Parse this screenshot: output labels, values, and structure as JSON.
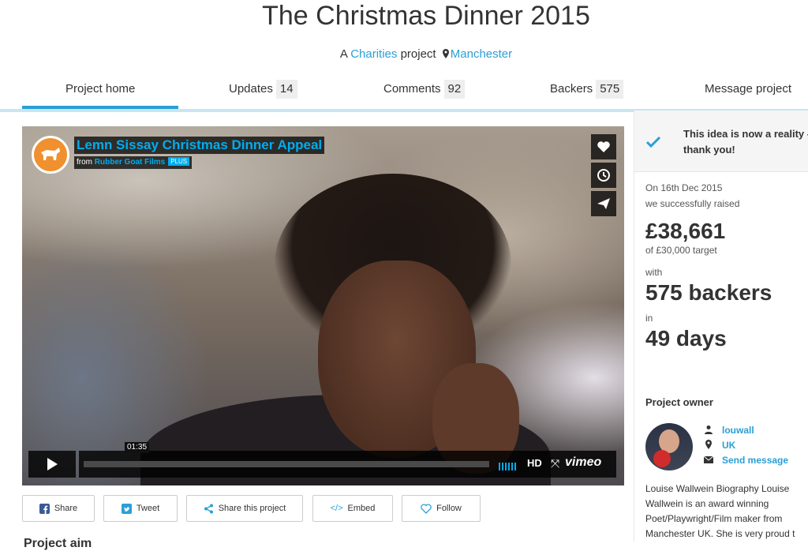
{
  "page": {
    "title": "The Christmas Dinner 2015",
    "subtitle_prefix": "A",
    "category_link": "Charities",
    "subtitle_middle": "project",
    "location_link": "Manchester"
  },
  "tabs": [
    {
      "label": "Project home",
      "count": ""
    },
    {
      "label": "Updates",
      "count": "14"
    },
    {
      "label": "Comments",
      "count": "92"
    },
    {
      "label": "Backers",
      "count": "575"
    },
    {
      "label": "Message project",
      "count": ""
    }
  ],
  "video": {
    "title": "Lemn Sissay Christmas Dinner Appeal",
    "from_label": "from",
    "from_link": "Rubber Goat Films",
    "badge": "PLUS",
    "timecode": "01:35",
    "hd_label": "HD",
    "brand": "vimeo"
  },
  "share_buttons": [
    {
      "label": "Share",
      "icon": "facebook-icon"
    },
    {
      "label": "Tweet",
      "icon": "twitter-icon"
    },
    {
      "label": "Share this project",
      "icon": "share-icon"
    },
    {
      "label": "Embed",
      "icon": "code-icon"
    },
    {
      "label": "Follow",
      "icon": "heart-icon"
    }
  ],
  "sidebar": {
    "reality_line1": "This idea is now a reality -",
    "reality_line2": "thank you!",
    "date_line": "On 16th Dec 2015",
    "raised_label": "we successfully raised",
    "amount": "£38,661",
    "target": "of £30,000 target",
    "with_label": "with",
    "backers": "575 backers",
    "in_label": "in",
    "days": "49 days",
    "owner_heading": "Project owner",
    "owner_name": "louwall",
    "owner_location": "UK",
    "owner_message": "Send message",
    "bio": "Louise Wallwein Biography Louise Wallwein is an award winning Poet/Playwright/Film maker from Manchester UK. She is very proud t"
  },
  "section_heading_cut": "Project aim",
  "colors": {
    "accent": "#2a9fd6",
    "tab_underline": "#c6e6f2",
    "vimeo_blue": "#00adef",
    "check": "#2a9fd6"
  }
}
